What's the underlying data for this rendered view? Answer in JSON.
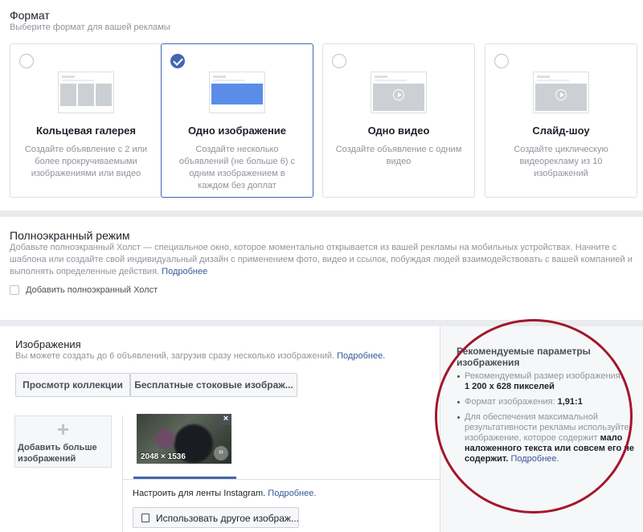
{
  "format": {
    "title": "Формат",
    "subtitle": "Выберите формат для вашей рекламы",
    "cards": [
      {
        "title": "Кольцевая галерея",
        "description": "Создайте объявление с 2 или более прокручиваемыми изображениями или видео",
        "selected": false,
        "icon": "carousel-thumbnail-icon"
      },
      {
        "title": "Одно изображение",
        "description": "Создайте несколько объявлений (не больше 6) с одним изображением в каждом без доплат",
        "selected": true,
        "icon": "single-image-thumbnail-icon"
      },
      {
        "title": "Одно видео",
        "description": "Создайте объявление с одним видео",
        "selected": false,
        "icon": "single-video-thumbnail-icon"
      },
      {
        "title": "Слайд-шоу",
        "description": "Создайте циклическую видеорекламу из 10 изображений",
        "selected": false,
        "icon": "slideshow-thumbnail-icon"
      }
    ]
  },
  "fullscreen": {
    "title": "Полноэкранный режим",
    "description": "Добавьте полноэкранный Холст — специальное окно, которое моментально открывается из вашей рекламы на мобильных устройствах. Начните с шаблона или создайте свой индивидуальный дизайн с применением фото, видео и ссылок, побуждая людей взаимодействовать с вашей компанией и выполнять определенные действия.",
    "more_link": "Подробнее",
    "checkbox_label": "Добавить полноэкранный Холст",
    "checked": false
  },
  "images": {
    "title": "Изображения",
    "subtitle": "Вы можете создать до 6 объявлений, загрузив сразу несколько изображений.",
    "more_link": "Подробнее.",
    "browse_button": "Просмотр коллекции",
    "stock_button": "Бесплатные стоковые изображ...",
    "add_more_plus": "+",
    "add_more_label": "Добавить больше изображений",
    "thumbnail_dims": "2048 × 1536",
    "thumbnail_close": "×",
    "thumbnail_crop": "⌗",
    "instagram_text": "Настроить для ленты Instagram.",
    "instagram_link": "Подробнее.",
    "other_image_button": "Использовать другое изображ..."
  },
  "recommend": {
    "title": "Рекомендуемые параметры изображения",
    "size_label": "Рекомендуемый размер изображения:",
    "size_value": "1 200 x 628 пикселей",
    "format_label": "Формат изображения:",
    "format_value": "1,91:1",
    "tip_text": "Для обеспечения максимальной результативности рекламы используйте изображение, которое содержит",
    "tip_bold": "мало наложенного текста или совсем его не содержит.",
    "tip_link": "Подробнее.",
    "ring_color": "#a3172b"
  },
  "colors": {
    "accent": "#4267b2",
    "link": "#365899",
    "separator": "#e9ebee"
  }
}
